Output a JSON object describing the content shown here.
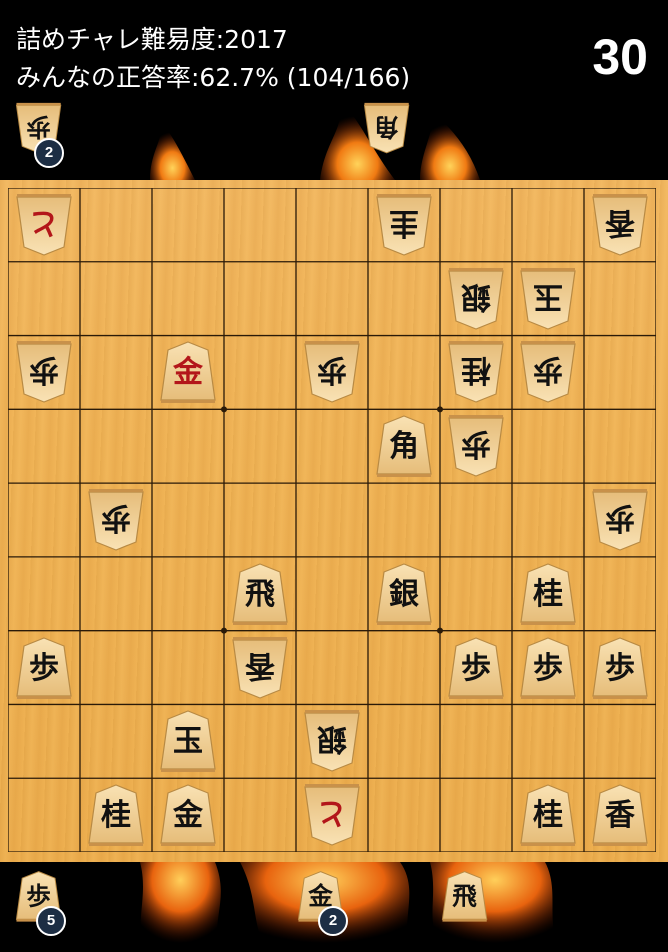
{
  "header": {
    "line1": "詰めチャレ難易度:2017",
    "line2": "みんなの正答率:62.7% (104/166)",
    "timer": "30"
  },
  "board": {
    "pieces": [
      {
        "file": 9,
        "rank": 1,
        "char": "と",
        "side": "gote",
        "red": true
      },
      {
        "file": 4,
        "rank": 1,
        "char": "圭",
        "side": "gote",
        "red": false
      },
      {
        "file": 1,
        "rank": 1,
        "char": "香",
        "side": "gote",
        "red": false
      },
      {
        "file": 3,
        "rank": 2,
        "char": "銀",
        "side": "gote",
        "red": false
      },
      {
        "file": 2,
        "rank": 2,
        "char": "玉",
        "side": "gote",
        "red": false
      },
      {
        "file": 9,
        "rank": 3,
        "char": "歩",
        "side": "gote",
        "red": false
      },
      {
        "file": 7,
        "rank": 3,
        "char": "金",
        "side": "sente",
        "red": true
      },
      {
        "file": 5,
        "rank": 3,
        "char": "歩",
        "side": "gote",
        "red": false
      },
      {
        "file": 3,
        "rank": 3,
        "char": "桂",
        "side": "gote",
        "red": false
      },
      {
        "file": 2,
        "rank": 3,
        "char": "歩",
        "side": "gote",
        "red": false
      },
      {
        "file": 4,
        "rank": 4,
        "char": "角",
        "side": "sente",
        "red": false
      },
      {
        "file": 3,
        "rank": 4,
        "char": "歩",
        "side": "gote",
        "red": false
      },
      {
        "file": 8,
        "rank": 5,
        "char": "歩",
        "side": "gote",
        "red": false
      },
      {
        "file": 1,
        "rank": 5,
        "char": "歩",
        "side": "gote",
        "red": false
      },
      {
        "file": 6,
        "rank": 6,
        "char": "飛",
        "side": "sente",
        "red": false
      },
      {
        "file": 4,
        "rank": 6,
        "char": "銀",
        "side": "sente",
        "red": false
      },
      {
        "file": 2,
        "rank": 6,
        "char": "桂",
        "side": "sente",
        "red": false
      },
      {
        "file": 9,
        "rank": 7,
        "char": "歩",
        "side": "sente",
        "red": false
      },
      {
        "file": 6,
        "rank": 7,
        "char": "香",
        "side": "gote",
        "red": false
      },
      {
        "file": 3,
        "rank": 7,
        "char": "歩",
        "side": "sente",
        "red": false
      },
      {
        "file": 2,
        "rank": 7,
        "char": "歩",
        "side": "sente",
        "red": false
      },
      {
        "file": 1,
        "rank": 7,
        "char": "歩",
        "side": "sente",
        "red": false
      },
      {
        "file": 7,
        "rank": 8,
        "char": "玉",
        "side": "sente",
        "red": false
      },
      {
        "file": 5,
        "rank": 8,
        "char": "銀",
        "side": "gote",
        "red": false
      },
      {
        "file": 8,
        "rank": 9,
        "char": "桂",
        "side": "sente",
        "red": false
      },
      {
        "file": 7,
        "rank": 9,
        "char": "金",
        "side": "sente",
        "red": false
      },
      {
        "file": 5,
        "rank": 9,
        "char": "と",
        "side": "gote",
        "red": true
      },
      {
        "file": 2,
        "rank": 9,
        "char": "桂",
        "side": "sente",
        "red": false
      },
      {
        "file": 1,
        "rank": 9,
        "char": "香",
        "side": "sente",
        "red": false
      }
    ]
  },
  "gote_hand": [
    {
      "char": "歩",
      "count": "2"
    },
    {
      "char": "角",
      "count": ""
    }
  ],
  "sente_hand": [
    {
      "char": "歩",
      "count": "5"
    },
    {
      "char": "金",
      "count": "2"
    },
    {
      "char": "飛",
      "count": ""
    }
  ]
}
